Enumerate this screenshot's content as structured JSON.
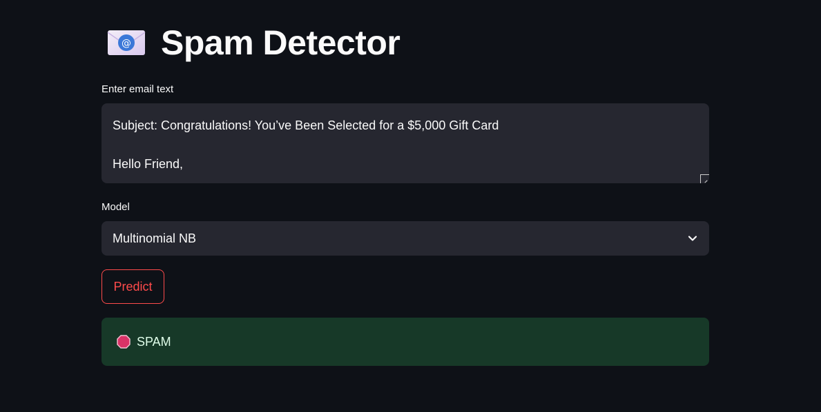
{
  "header": {
    "title": "Spam Detector",
    "icon": "email-envelope-icon"
  },
  "email_input": {
    "label": "Enter email text",
    "lines": [
      "Subject: Congratulations! You’ve Been Selected for a $5,000 Gift Card",
      "",
      "Hello Friend,"
    ]
  },
  "model_select": {
    "label": "Model",
    "selected": "Multinomial NB",
    "icon": "chevron-down-icon"
  },
  "predict_button": {
    "label": "Predict"
  },
  "result": {
    "icon": "stop-sign-icon",
    "text": "SPAM"
  },
  "colors": {
    "background": "#0e1117",
    "input_background": "#262730",
    "accent": "#ff4b4b",
    "success_background": "#173928",
    "text": "#fafafa"
  }
}
